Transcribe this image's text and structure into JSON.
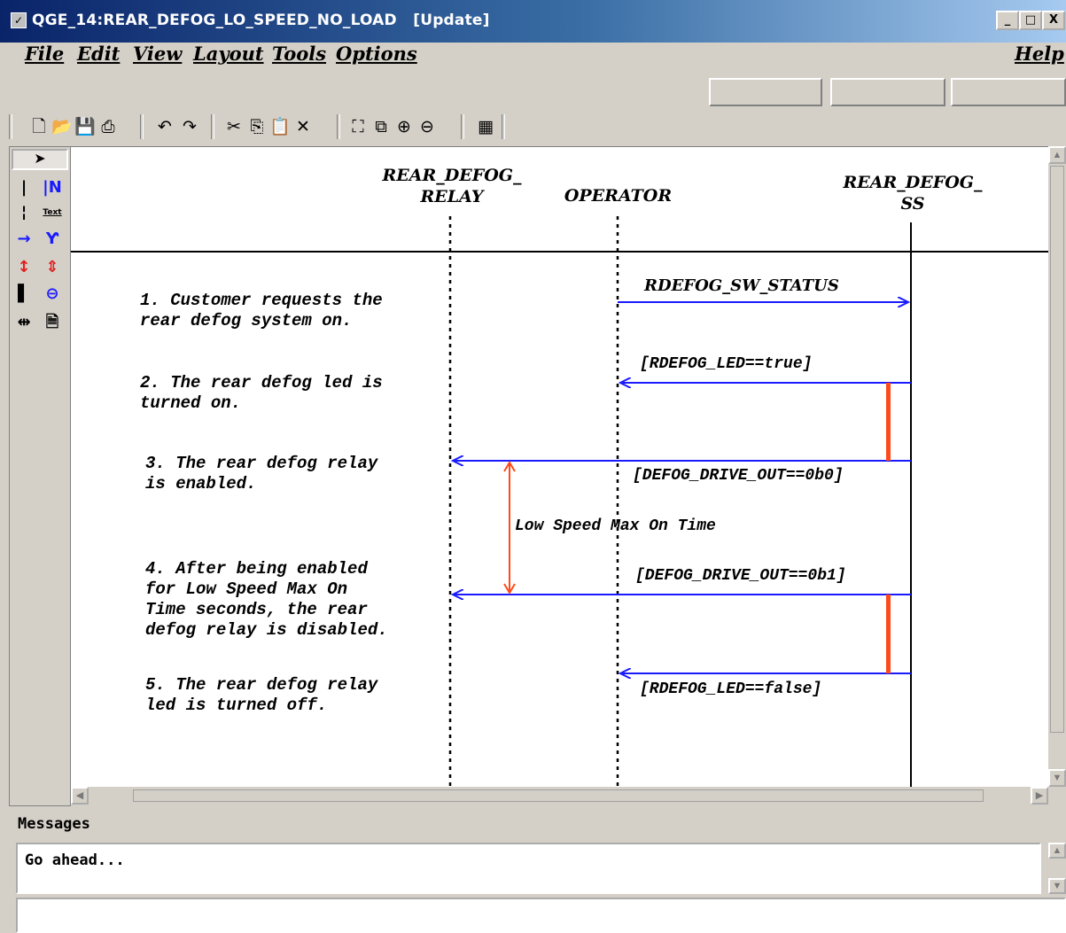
{
  "window": {
    "title": "QGE_14:REAR_DEFOG_LO_SPEED_NO_LOAD",
    "state": "[Update]",
    "icon": "app-icon",
    "controls": {
      "minimize": "_",
      "restore": "□",
      "close": "X"
    }
  },
  "menu": {
    "file": "File",
    "edit": "Edit",
    "view": "View",
    "layout": "Layout",
    "tools": "Tools",
    "options": "Options",
    "help": "Help"
  },
  "toolbar_icons": [
    "new-icon",
    "open-icon",
    "save-icon",
    "print-icon",
    "undo-icon",
    "redo-icon",
    "cut-icon",
    "copy-icon",
    "paste-icon",
    "delete-icon",
    "fit-icon",
    "zoom-area-icon",
    "zoom-in-icon",
    "zoom-out-icon",
    "grid-icon"
  ],
  "palette": {
    "lifeline_label": "N",
    "text_label": "Text"
  },
  "diagram": {
    "actors": {
      "relay": "REAR_DEFOG_\nRELAY",
      "operator": "OPERATOR",
      "ss": "REAR_DEFOG_\nSS"
    },
    "steps": {
      "s1": "1. Customer requests the\nrear defog system on.",
      "s2": "2. The rear defog led is\nturned on.",
      "s3": "3. The rear defog relay\nis enabled.",
      "s4": "4. After being enabled\nfor Low Speed Max On\nTime seconds, the rear\ndefog relay is disabled.",
      "s5": "5. The rear defog relay\nled is turned off."
    },
    "messages": {
      "m1": "RDEFOG_SW_STATUS",
      "m2": "[RDEFOG_LED==true]",
      "m3": "[DEFOG_DRIVE_OUT==0b0]",
      "m4": "[DEFOG_DRIVE_OUT==0b1]",
      "m5": "[RDEFOG_LED==false]"
    },
    "timing_label": "Low Speed Max On Time",
    "colors": {
      "message": "#1a1aff",
      "timing": "#ff4a1a",
      "lifeline": "#000000"
    }
  },
  "messages_panel": {
    "label": "Messages",
    "text": "Go ahead..."
  },
  "command_input": {
    "value": ""
  }
}
